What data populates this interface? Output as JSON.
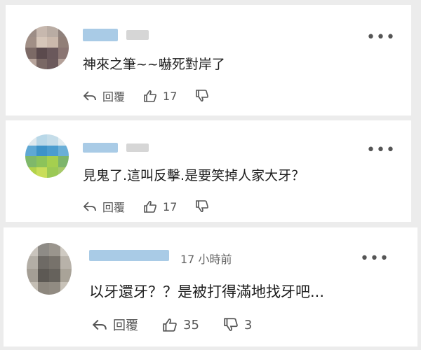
{
  "comments": [
    {
      "time": "",
      "text": "神來之筆~~嚇死對岸了",
      "reply_label": "回覆",
      "likes": "17",
      "dislikes": "",
      "avatar_colors": [
        "#9c8d86",
        "#c7b8ae",
        "#b9aca3",
        "#8f817b",
        "#a18f86",
        "#d6c6b9",
        "#cbb9ac",
        "#917f77",
        "#7c6a66",
        "#5b4a4d",
        "#6a585b",
        "#8a7572",
        "#b7a49b",
        "#7a6865",
        "#6c5a5c",
        "#b3a098"
      ]
    },
    {
      "time": "",
      "text": "見鬼了.這叫反擊.是要笑掉人家大牙？",
      "reply_label": "回覆",
      "likes": "17",
      "dislikes": "",
      "avatar_colors": [
        "#dfe9ee",
        "#b9d8e8",
        "#c5dde9",
        "#e2ecf0",
        "#5fa8d4",
        "#3d93c8",
        "#4b9dcf",
        "#6aafd8",
        "#7fb86a",
        "#8cc35a",
        "#a5cf4f",
        "#7db56b",
        "#b2d24a",
        "#c9dd5a",
        "#9bc955",
        "#a7c96a"
      ]
    },
    {
      "time": "17 小時前",
      "text": "以牙還牙？？是被打得滿地找牙吧...",
      "reply_label": "回覆",
      "likes": "35",
      "dislikes": "3",
      "avatar_colors": [
        "#c9c4bd",
        "#8e8b86",
        "#9a958d",
        "#cfcac2",
        "#b3aea6",
        "#6e6a65",
        "#77726b",
        "#b8b2a9",
        "#a49e95",
        "#5d5954",
        "#66625c",
        "#a9a398",
        "#c4beb4",
        "#8d877e",
        "#918b82",
        "#c8c2b8"
      ]
    }
  ],
  "icons": {
    "reply": "reply-arrow-icon",
    "like": "thumbs-up-icon",
    "dislike": "thumbs-down-icon",
    "more": "more-horizontal-icon"
  }
}
